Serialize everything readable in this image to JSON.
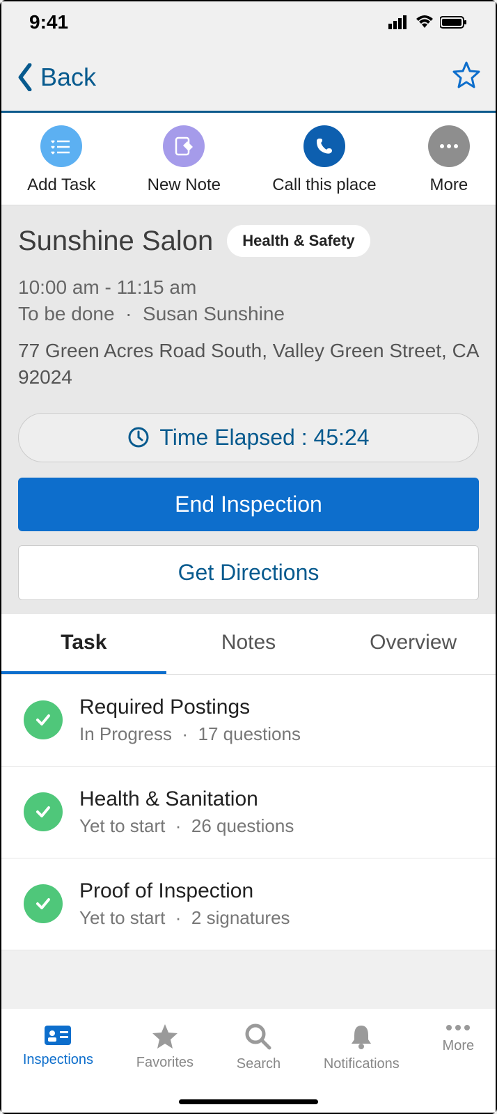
{
  "status_bar": {
    "time": "9:41"
  },
  "nav": {
    "back": "Back"
  },
  "actions": {
    "add_task": "Add Task",
    "new_note": "New Note",
    "call": "Call this place",
    "more": "More"
  },
  "place": {
    "name": "Sunshine Salon",
    "badge": "Health & Safety",
    "time_range": "10:00 am - 11:15 am",
    "status": "To be done",
    "separator": "·",
    "contact": "Susan Sunshine",
    "address": "77 Green Acres Road South, Valley Green Street, CA 92024"
  },
  "timer": {
    "label": "Time Elapsed : 45:24"
  },
  "buttons": {
    "end": "End Inspection",
    "directions": "Get Directions"
  },
  "tabs": {
    "task": "Task",
    "notes": "Notes",
    "overview": "Overview"
  },
  "tasks": [
    {
      "title": "Required Postings",
      "status": "In Progress",
      "meta": "17 questions"
    },
    {
      "title": "Health & Sanitation",
      "status": "Yet to start",
      "meta": "26 questions"
    },
    {
      "title": "Proof of Inspection",
      "status": "Yet to start",
      "meta": "2 signatures"
    }
  ],
  "bottom_nav": {
    "inspections": "Inspections",
    "favorites": "Favorites",
    "search": "Search",
    "notifications": "Notifications",
    "more": "More"
  }
}
